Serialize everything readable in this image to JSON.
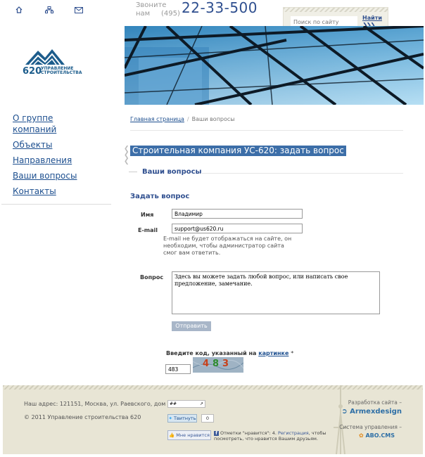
{
  "header": {
    "phone_label": "Звоните нам",
    "phone_code": "(495)",
    "phone_number": "22-33-500",
    "search_placeholder": "Поиск по сайту",
    "search_button": "Найти"
  },
  "logo": {
    "number": "620",
    "line1": "Управление",
    "line2": "строительства"
  },
  "nav": {
    "items": [
      {
        "label": "О группе компаний"
      },
      {
        "label": "Объекты"
      },
      {
        "label": "Направления"
      },
      {
        "label": "Ваши вопросы"
      },
      {
        "label": "Контакты"
      }
    ]
  },
  "breadcrumb": {
    "home": "Главная страница",
    "separator": "/",
    "current": "Ваши вопросы"
  },
  "page": {
    "title": "Строительная компания УС-620: задать вопрос",
    "section": "Ваши вопросы",
    "form_title": "Задать вопрос"
  },
  "form": {
    "name_label": "Имя",
    "name_value": "Владимир",
    "email_label": "E-mail",
    "email_value": "support@us620.ru",
    "email_hint": "E-mail не будет отображаться на сайте, он необходим, чтобы администратор сайта смог вам ответить.",
    "question_label": "Вопрос",
    "question_value": "Здесь вы можете задать любой вопрос, или написать свое предложение, замечание.",
    "submit_label": "Отправить",
    "captcha_label": "Введите код, указанный на",
    "captcha_link": "картинке",
    "captcha_required": "*",
    "captcha_value": "483",
    "captcha_digits": [
      "4",
      "8",
      "3"
    ]
  },
  "footer": {
    "address": "Наш адрес: 121151, Москва, ул. Раевского, дом 4",
    "copyright": "© 2011 Управление строительства 620",
    "counter_text": "##",
    "tweet_label": "Твитнуть",
    "tweet_count": "0",
    "like_label": "Мне нравится",
    "fb_text_before": "Отметки \"нравится\": 4.",
    "fb_link": "Регистрация",
    "fb_text_after": ", чтобы посмотреть, что нравится Вашим друзьям.",
    "dev_label": "Разработка сайта –",
    "dev_name": "Armexdesign",
    "sys_label": "Система управления –",
    "sys_name": "ABO.CMS"
  },
  "colors": {
    "link": "#1d4f8f",
    "title_bg": "#3c6ea8",
    "footer_bg": "#e8e5d5"
  }
}
